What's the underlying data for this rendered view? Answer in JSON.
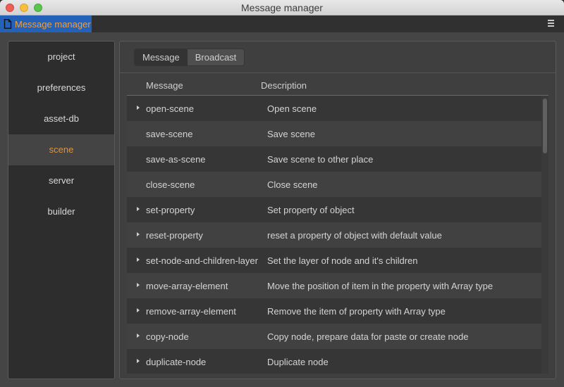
{
  "window": {
    "title": "Message manager"
  },
  "tabbar": {
    "panel_tab_label": "Message manager",
    "panel_tab_icon": "document-icon",
    "menu_icon": "hamburger-menu-icon"
  },
  "colors": {
    "accent": "#e0943d",
    "tab_active_bg": "#2461b9",
    "tab_label": "#f0a040"
  },
  "sidebar": {
    "items": [
      {
        "label": "project",
        "active": false
      },
      {
        "label": "preferences",
        "active": false
      },
      {
        "label": "asset-db",
        "active": false
      },
      {
        "label": "scene",
        "active": true
      },
      {
        "label": "server",
        "active": false
      },
      {
        "label": "builder",
        "active": false
      }
    ]
  },
  "main": {
    "segments": [
      {
        "label": "Message",
        "active": true
      },
      {
        "label": "Broadcast",
        "active": false
      }
    ],
    "columns": {
      "message": "Message",
      "description": "Description"
    },
    "rows": [
      {
        "name": "open-scene",
        "description": "Open scene",
        "expandable": true
      },
      {
        "name": "save-scene",
        "description": "Save scene",
        "expandable": false
      },
      {
        "name": "save-as-scene",
        "description": "Save scene to other place",
        "expandable": false
      },
      {
        "name": "close-scene",
        "description": "Close scene",
        "expandable": false
      },
      {
        "name": "set-property",
        "description": "Set property of object",
        "expandable": true
      },
      {
        "name": "reset-property",
        "description": "reset a property of object with default value",
        "expandable": true
      },
      {
        "name": "set-node-and-children-layer",
        "description": "Set the layer of node and it's children",
        "expandable": true
      },
      {
        "name": "move-array-element",
        "description": "Move the position of item in the property with Array type",
        "expandable": true
      },
      {
        "name": "remove-array-element",
        "description": "Remove the item of property with Array type",
        "expandable": true
      },
      {
        "name": "copy-node",
        "description": "Copy node, prepare data for paste or create node",
        "expandable": true
      },
      {
        "name": "duplicate-node",
        "description": "Duplicate node",
        "expandable": true
      }
    ]
  }
}
